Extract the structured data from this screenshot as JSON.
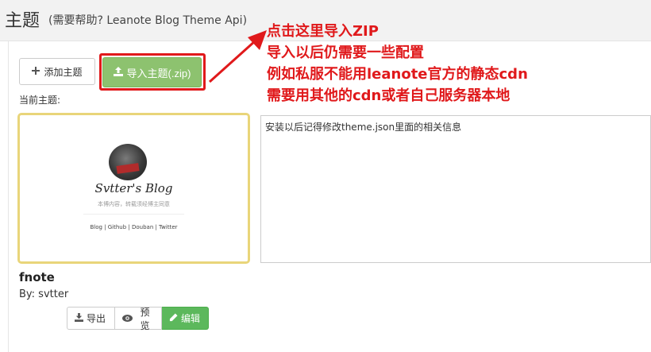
{
  "header": {
    "title": "主题",
    "subtitle": "(需要帮助? Leanote Blog Theme Api)"
  },
  "toolbar": {
    "add_label": "添加主题",
    "import_label": "导入主题(.zip)"
  },
  "current_label": "当前主题:",
  "theme": {
    "thumbnail": {
      "blog_name": "Svtter's Blog",
      "tagline": "本博内容，转载须经博主同意",
      "links": "Blog | Github | Douban | Twitter"
    },
    "name": "fnote",
    "author": "By: svtter"
  },
  "actions": {
    "export_label": "导出",
    "preview_label": "预览",
    "edit_label": "编辑"
  },
  "info_text": "安装以后记得修改theme.json里面的相关信息",
  "annotation": {
    "line1": "点击这里导入ZIP",
    "line2": "导入以后仍需要一些配置",
    "line3": "例如私服不能用leanote官方的静态cdn",
    "line4": "需要用其他的cdn或者自己服务器本地"
  },
  "colors": {
    "accent_red": "#e0191b",
    "import_green": "#8dc26f",
    "edit_green": "#5cb85c",
    "thumb_border": "#e9d57a"
  },
  "icons": {
    "add": "plus-icon",
    "import": "upload-icon",
    "export": "download-icon",
    "preview": "eye-icon",
    "edit": "pencil-icon"
  }
}
